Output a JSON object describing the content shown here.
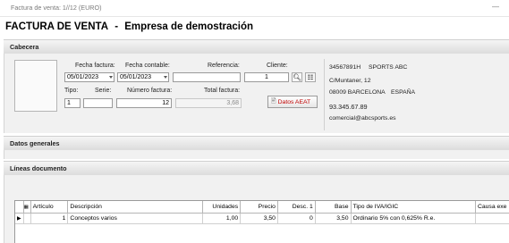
{
  "window": {
    "title": "Factura de venta: 1//12 (EURO)"
  },
  "header": {
    "doc_title": "FACTURA DE VENTA",
    "company": "Empresa de demostración"
  },
  "sections": {
    "cabecera": "Cabecera",
    "datos_generales": "Datos generales",
    "lineas": "Líneas documento"
  },
  "form": {
    "fecha_factura_label": "Fecha factura:",
    "fecha_factura": "05/01/2023",
    "fecha_contable_label": "Fecha contable:",
    "fecha_contable": "05/01/2023",
    "referencia_label": "Referencia:",
    "referencia": "",
    "cliente_label": "Cliente:",
    "cliente": "1",
    "tipo_label": "Tipo:",
    "tipo": "1",
    "serie_label": "Serie:",
    "serie": "",
    "numero_label": "Número factura:",
    "numero": "12",
    "total_label": "Total factura:",
    "total": "3,68",
    "aeat_button": "Datos AEAT"
  },
  "client_info": {
    "nif": "34567891H",
    "name": "SPORTS ABC",
    "address": "C/Muntaner, 12",
    "postal": "08009 BARCELONA",
    "country": "ESPAÑA",
    "phone": "93.345.67.89",
    "email": "comercial@abcsports.es"
  },
  "lines_table": {
    "columns": [
      "Artículo",
      "Descripción",
      "Unidades",
      "Precio",
      "Desc. 1",
      "Base",
      "Tipo de IVA/IGIC",
      "Causa exe"
    ],
    "rows": [
      [
        "1",
        "Conceptos varios",
        "1,00",
        "3,50",
        "0",
        "3,50",
        "Ordinario 5% con 0,625% R.e.",
        ""
      ]
    ]
  },
  "icons": {
    "search": "search-icon",
    "client_card": "client-card-icon",
    "aeat": "document-icon",
    "row_pointer": "row-pointer-icon",
    "grid_corner": "grid-corner-icon"
  }
}
